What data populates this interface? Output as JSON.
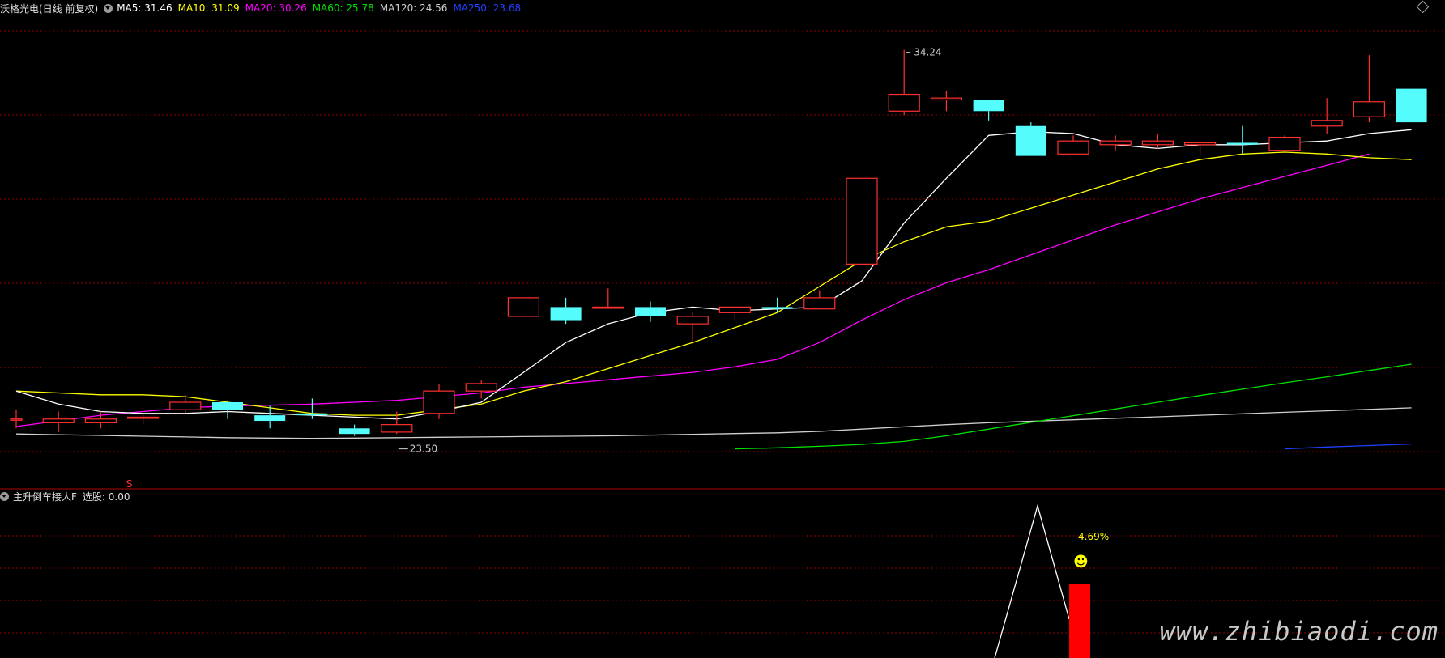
{
  "main_header": {
    "title": "沃格光电(日线 前复权)",
    "indicators": [
      {
        "label": "MA5: 31.46",
        "color": "#ffffff"
      },
      {
        "label": "MA10: 31.09",
        "color": "#ffff00"
      },
      {
        "label": "MA20: 30.26",
        "color": "#ff00ff"
      },
      {
        "label": "MA60: 25.78",
        "color": "#00e000"
      },
      {
        "label": "MA120: 24.56",
        "color": "#d0d0d0"
      },
      {
        "label": "MA250: 23.68",
        "color": "#2040ff"
      }
    ]
  },
  "sub_header": {
    "name": "主升倒车接人F",
    "select_label": "选股: 0.00"
  },
  "annotations": {
    "high_label": "34.24",
    "low_label": "23.50",
    "signal_mark": "S",
    "percent_label": "4.69%",
    "emoji": "☻"
  },
  "watermark": "www.zhibiaodi.com",
  "colors": {
    "up": "#ff3030",
    "down": "#54fcfc",
    "grid": "#8b0000",
    "ma5": "#ffffff",
    "ma10": "#ffff00",
    "ma20": "#ff00ff",
    "ma60": "#00e000",
    "ma120": "#d0d0d0",
    "ma250": "#2040ff"
  },
  "chart_data": {
    "type": "candlestick",
    "ylim": [
      23.0,
      35.1
    ],
    "candles": [
      {
        "o": 24.35,
        "c": 24.35,
        "h": 24.6,
        "l": 24.1
      },
      {
        "o": 24.25,
        "c": 24.35,
        "h": 24.55,
        "l": 24.0
      },
      {
        "o": 24.25,
        "c": 24.35,
        "h": 24.55,
        "l": 24.1
      },
      {
        "o": 24.4,
        "c": 24.4,
        "h": 24.5,
        "l": 24.2
      },
      {
        "o": 24.6,
        "c": 24.8,
        "h": 25.0,
        "l": 24.5
      },
      {
        "o": 24.8,
        "c": 24.6,
        "h": 24.85,
        "l": 24.35
      },
      {
        "o": 24.45,
        "c": 24.3,
        "h": 24.7,
        "l": 24.1
      },
      {
        "o": 24.5,
        "c": 24.45,
        "h": 24.9,
        "l": 24.35
      },
      {
        "o": 24.1,
        "c": 23.95,
        "h": 24.2,
        "l": 23.9
      },
      {
        "o": 24.0,
        "c": 24.2,
        "h": 24.55,
        "l": 23.95
      },
      {
        "o": 24.5,
        "c": 25.1,
        "h": 25.3,
        "l": 24.35
      },
      {
        "o": 25.1,
        "c": 25.3,
        "h": 25.4,
        "l": 24.9
      },
      {
        "o": 27.1,
        "c": 27.6,
        "h": 27.6,
        "l": 27.1
      },
      {
        "o": 27.35,
        "c": 27.0,
        "h": 27.6,
        "l": 26.9
      },
      {
        "o": 27.35,
        "c": 27.35,
        "h": 27.85,
        "l": 27.3
      },
      {
        "o": 27.35,
        "c": 27.1,
        "h": 27.5,
        "l": 26.95
      },
      {
        "o": 26.9,
        "c": 27.1,
        "h": 27.2,
        "l": 26.45
      },
      {
        "o": 27.2,
        "c": 27.35,
        "h": 27.35,
        "l": 27.0
      },
      {
        "o": 27.35,
        "c": 27.3,
        "h": 27.6,
        "l": 27.2
      },
      {
        "o": 27.3,
        "c": 27.6,
        "h": 27.8,
        "l": 27.3
      },
      {
        "o": 28.5,
        "c": 30.8,
        "h": 30.8,
        "l": 28.5
      },
      {
        "o": 32.6,
        "c": 33.05,
        "h": 34.24,
        "l": 32.5
      },
      {
        "o": 32.9,
        "c": 32.95,
        "h": 33.15,
        "l": 32.6
      },
      {
        "o": 32.9,
        "c": 32.6,
        "h": 32.9,
        "l": 32.35
      },
      {
        "o": 32.2,
        "c": 31.4,
        "h": 32.3,
        "l": 31.4
      },
      {
        "o": 31.45,
        "c": 31.8,
        "h": 31.95,
        "l": 31.45
      },
      {
        "o": 31.7,
        "c": 31.8,
        "h": 31.95,
        "l": 31.55
      },
      {
        "o": 31.7,
        "c": 31.8,
        "h": 32.0,
        "l": 31.6
      },
      {
        "o": 31.7,
        "c": 31.75,
        "h": 31.75,
        "l": 31.45
      },
      {
        "o": 31.75,
        "c": 31.7,
        "h": 32.2,
        "l": 31.45
      },
      {
        "o": 31.55,
        "c": 31.9,
        "h": 31.95,
        "l": 31.55
      },
      {
        "o": 32.2,
        "c": 32.35,
        "h": 32.95,
        "l": 32.0
      },
      {
        "o": 32.45,
        "c": 32.85,
        "h": 34.1,
        "l": 32.3
      },
      {
        "o": 33.2,
        "c": 32.3,
        "h": 33.2,
        "l": 32.3
      }
    ],
    "ma5": [
      25.1,
      24.75,
      24.55,
      24.5,
      24.5,
      24.55,
      24.5,
      24.45,
      24.4,
      24.35,
      24.55,
      24.8,
      25.6,
      26.4,
      26.9,
      27.2,
      27.35,
      27.25,
      27.3,
      27.35,
      28.05,
      29.6,
      30.8,
      31.95,
      32.05,
      32.0,
      31.7,
      31.6,
      31.7,
      31.7,
      31.75,
      31.8,
      32.0,
      32.1
    ],
    "ma10": [
      25.1,
      25.05,
      25.0,
      25.0,
      24.95,
      24.8,
      24.65,
      24.5,
      24.45,
      24.45,
      24.6,
      24.75,
      25.1,
      25.35,
      25.7,
      26.05,
      26.4,
      26.8,
      27.2,
      27.9,
      28.6,
      29.1,
      29.5,
      29.65,
      30.0,
      30.35,
      30.7,
      31.05,
      31.3,
      31.45,
      31.5,
      31.45,
      31.35,
      31.3
    ],
    "ma20": [
      24.15,
      24.3,
      24.45,
      24.55,
      24.65,
      24.7,
      24.72,
      24.75,
      24.8,
      24.85,
      24.95,
      25.05,
      25.2,
      25.3,
      25.4,
      25.5,
      25.6,
      25.75,
      25.95,
      26.4,
      27.0,
      27.55,
      28.0,
      28.35,
      28.75,
      29.15,
      29.55,
      29.9,
      30.25,
      30.55,
      30.85,
      31.15,
      31.45
    ],
    "ma60": [
      23.55,
      23.58,
      23.62,
      23.67,
      23.75,
      23.9,
      24.08,
      24.26,
      24.44,
      24.62,
      24.8,
      24.98,
      25.15,
      25.32,
      25.48,
      25.65,
      25.82
    ],
    "ma120": [
      23.95,
      23.93,
      23.91,
      23.89,
      23.87,
      23.85,
      23.84,
      23.83,
      23.84,
      23.85,
      23.86,
      23.87,
      23.88,
      23.89,
      23.9,
      23.92,
      23.94,
      23.96,
      23.98,
      24.02,
      24.08,
      24.14,
      24.2,
      24.25,
      24.29,
      24.33,
      24.37,
      24.41,
      24.45,
      24.49,
      24.53,
      24.57,
      24.61,
      24.65
    ],
    "ma250": [
      23.55,
      23.6,
      23.64,
      23.68
    ],
    "sub_indicator": {
      "line_points": [
        0,
        1,
        0.36
      ],
      "bar_value": 4.69
    }
  }
}
